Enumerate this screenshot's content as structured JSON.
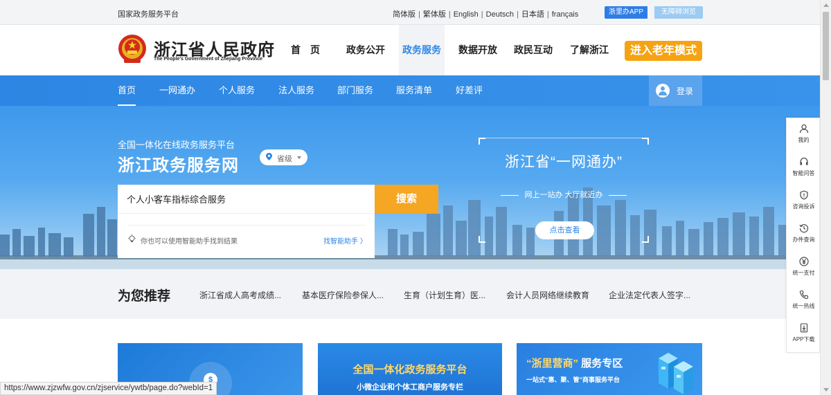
{
  "topbar": {
    "left_text": "国家政务服务平台",
    "languages": [
      "简体版",
      "繁体版",
      "English",
      "Deutsch",
      "日本語",
      "français"
    ],
    "app_button": "浙里办APP",
    "accessibility_button": "无障碍浏览"
  },
  "header": {
    "logo_cn": "浙江省人民政府",
    "logo_en": "The People's Government of Zhejiang Province",
    "nav": [
      "首　页",
      "政务公开",
      "政务服务",
      "数据开放",
      "政民互动",
      "了解浙江"
    ],
    "active_nav": "政务服务",
    "elder_mode": "进入老年模式"
  },
  "subnav": {
    "items": [
      "首页",
      "一网通办",
      "个人服务",
      "法人服务",
      "部门服务",
      "服务清单",
      "好差评"
    ],
    "active": "首页",
    "login": "登录"
  },
  "hero": {
    "subtitle": "全国一体化在线政务服务平台",
    "title": "浙江政务服务网",
    "level": "省级",
    "search_value": "个人小客车指标综合服务",
    "search_button": "搜索",
    "hint": "你也可以使用智能助手找到结果",
    "hint_link": "找智能助手 〉",
    "promo_title": "浙江省“一网通办”",
    "promo_slogan": "网上一站办  大厅就近办",
    "promo_button": "点击查看"
  },
  "recommend": {
    "heading": "为您推荐",
    "items": [
      "浙江省成人高考成绩...",
      "基本医疗保险参保人...",
      "生育（计划生育）医...",
      "会计人员网络继续教育",
      "企业法定代表人签字..."
    ]
  },
  "cards": {
    "card2_title": "全国一体化政务服务平台",
    "card2_sub": "小微企业和个体工商户服务专栏",
    "card3_title_quote": "“浙里营商”",
    "card3_title_rest": "服务专区",
    "card3_sub": "一站式“惠、聚、管”商事服务平台"
  },
  "sidebar": {
    "items": [
      {
        "label": "我的",
        "icon": "user-icon"
      },
      {
        "label": "智能问答",
        "icon": "headset-icon"
      },
      {
        "label": "咨询投诉",
        "icon": "shield-icon"
      },
      {
        "label": "办件查询",
        "icon": "history-icon"
      },
      {
        "label": "统一支付",
        "icon": "yen-icon"
      },
      {
        "label": "统一热线",
        "icon": "phone-icon"
      },
      {
        "label": "APP下载",
        "icon": "download-icon"
      }
    ]
  },
  "status_url": "https://www.zjzwfw.gov.cn/zjservice/ywtb/page.do?webId=1",
  "colors": {
    "primary_blue": "#2e86e8",
    "accent_orange": "#f5a623"
  }
}
